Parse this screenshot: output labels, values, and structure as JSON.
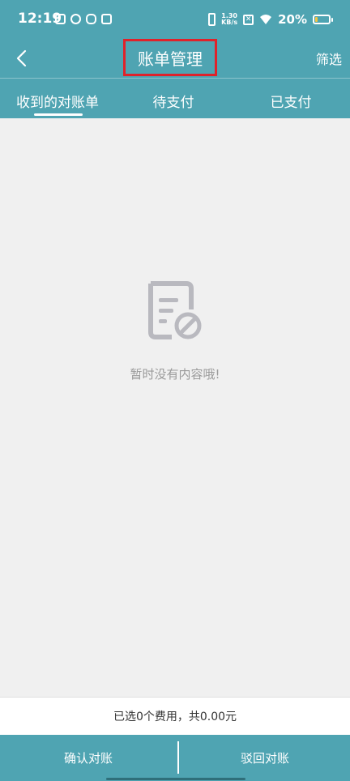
{
  "status_bar": {
    "time": "12:19",
    "net_speed_value": "1.30",
    "net_speed_unit": "KB/s",
    "battery_percent": "20%",
    "battery_level": 0.2,
    "icons": [
      "gallery-icon",
      "cloud-icon",
      "mail-icon",
      "calendar-icon",
      "vibrate-icon",
      "no-sim-icon",
      "wifi-icon",
      "battery-icon"
    ]
  },
  "header": {
    "back_icon": "chevron-left-icon",
    "title": "账单管理",
    "filter_label": "筛选"
  },
  "tabs": [
    {
      "label": "收到的对账单",
      "active": true
    },
    {
      "label": "待支付",
      "active": false
    },
    {
      "label": "已支付",
      "active": false
    }
  ],
  "empty_state": {
    "icon": "empty-document-icon",
    "message": "暂时没有内容哦!"
  },
  "summary": {
    "text": "已选0个费用，共0.00元"
  },
  "actions": {
    "confirm_label": "确认对账",
    "reject_label": "驳回对账"
  },
  "colors": {
    "primary": "#4fa4b2",
    "highlight_box": "#e0222a",
    "background": "#f0f0f0",
    "muted_text": "#9a9a9a"
  }
}
